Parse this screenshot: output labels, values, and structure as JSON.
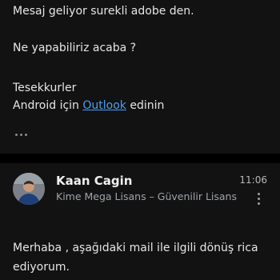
{
  "previous_message": {
    "line1": "Mesaj geliyor surekli adobe den.",
    "line2": "Ne yapabiliriz acaba ?",
    "line3": "Tesekkurler",
    "signature_prefix": "Android için ",
    "signature_link": "Outlook",
    "signature_suffix": " edinin",
    "show_more_icon": "ellipsis-icon"
  },
  "message": {
    "sender": "Kaan Cagin",
    "recipients": "Kime Mega Lisans – Güvenilir Lisans",
    "time": "11:06",
    "more_icon": "more-vertical-icon",
    "body": "Merhaba , aşağıdaki mail ile ilgili dönüş rica ediyorum."
  },
  "colors": {
    "background": "#121212",
    "divider": "#000000",
    "link": "#4a9ff5",
    "secondary_text": "#9ea3aa"
  }
}
